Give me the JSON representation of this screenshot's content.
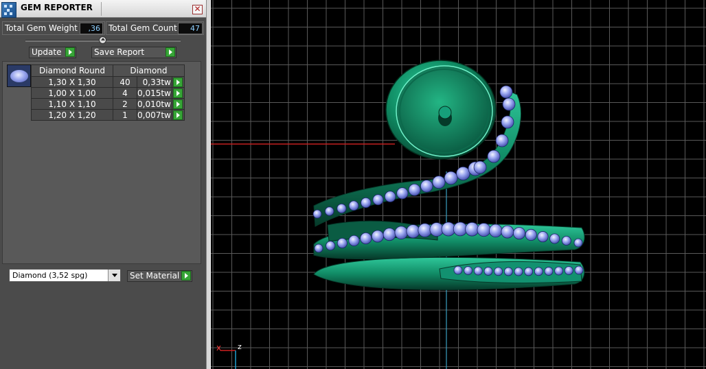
{
  "window": {
    "title": "GEM REPORTER",
    "close_glyph": "✕"
  },
  "totals": {
    "weight_label": "Total Gem Weight",
    "weight_value": ",36",
    "count_label": "Total Gem Count",
    "count_value": "47"
  },
  "actions": {
    "update_label": "Update",
    "save_report_label": "Save Report"
  },
  "gem_table": {
    "headers": [
      "Diamond Round",
      "Diamond"
    ],
    "rows": [
      {
        "size": "1,30 X 1,30",
        "count": "40",
        "weight": "0,33tw"
      },
      {
        "size": "1,00 X 1,00",
        "count": "4",
        "weight": "0,015tw"
      },
      {
        "size": "1,10 X 1,10",
        "count": "2",
        "weight": "0,010tw"
      },
      {
        "size": "1,20 X 1,20",
        "count": "1",
        "weight": "0,007tw"
      }
    ]
  },
  "material": {
    "selected": "Diamond     (3,52 spg)",
    "set_material_label": "Set Material"
  },
  "viewport": {
    "axis_x_label": "x",
    "axis_z_label": "z",
    "colors": {
      "background": "#000000",
      "grid": "#5a5a5a",
      "metal": "#1f8a6a",
      "gem": "#8a96e8"
    }
  },
  "icons": {
    "app": "gem-reporter-app-icon",
    "close": "close-icon",
    "arrow": "play-arrow-icon",
    "dropdown": "chevron-down-icon"
  }
}
